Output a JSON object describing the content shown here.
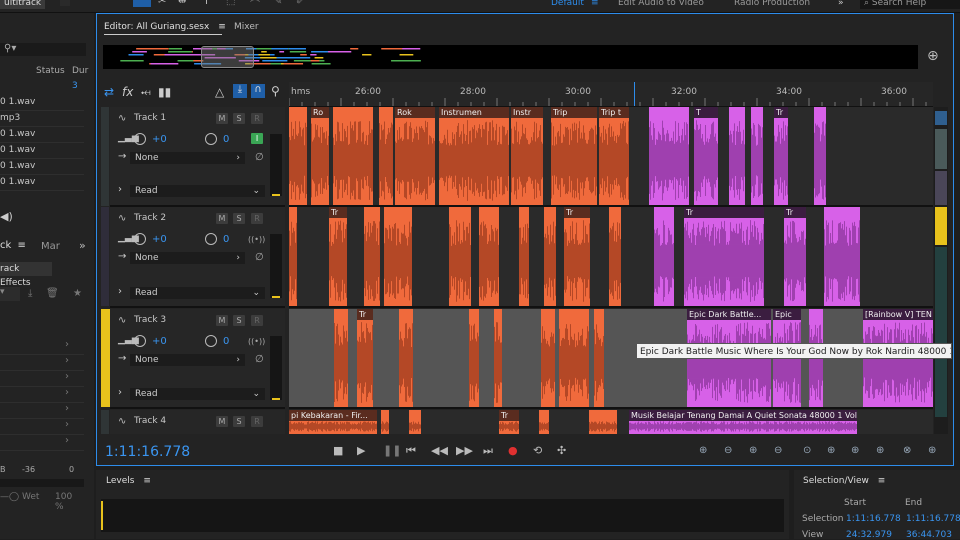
{
  "topbar": {
    "multitrack_tab": "ultitrack",
    "workspaces": [
      "Default",
      "Edit Audio to Video",
      "Radio Production"
    ],
    "overflow": "»",
    "search_placeholder": "Search Help"
  },
  "files": {
    "columns": [
      "Status",
      "Dur"
    ],
    "rows": [
      "0 1.wav",
      "mp3",
      "0 1.wav",
      "0 1.wav",
      "0 1.wav",
      "0 1.wav"
    ],
    "marker_count": "3"
  },
  "left_lower": {
    "tab_track": "ck",
    "tab_markers": "Mar",
    "overflow": "»",
    "track_effects_btn": "rack Effects",
    "meter_labels": [
      "B",
      "-36",
      "0"
    ],
    "wet_label": "Wet",
    "wet_value": "100 %"
  },
  "editor": {
    "tab_label": "Editor: All Guriang.sesx",
    "mixer_label": "Mixer"
  },
  "ruler": {
    "labels": [
      "hms",
      "26:00",
      "28:00",
      "30:00",
      "32:00",
      "34:00",
      "36:00"
    ]
  },
  "tracks": [
    {
      "name": "Track 1",
      "volume": "+0",
      "pan": "0",
      "input": "None",
      "automation": "Read"
    },
    {
      "name": "Track 2",
      "volume": "+0",
      "pan": "0",
      "input": "None",
      "automation": "Read"
    },
    {
      "name": "Track 3",
      "volume": "+0",
      "pan": "0",
      "input": "None",
      "automation": "Read"
    },
    {
      "name": "Track 4"
    }
  ],
  "track_buttons": {
    "mute": "M",
    "solo": "S",
    "record": "R",
    "input": "I"
  },
  "clips": {
    "t1": [
      "Ro",
      "Rok",
      "Instrumen",
      "Instr",
      "Trip",
      "Trip t",
      "T",
      "Tr"
    ],
    "t2": [
      "Tr",
      "Tr",
      "Tr",
      "Tr"
    ],
    "t3": [
      "Tr",
      "Epic Dark Battle...",
      "Epic",
      "[Rainbow V] TEN X"
    ],
    "t4": [
      "pi Kebakaran - Fir...",
      "Tr",
      "Musik Belajar Tenang Damai A Quiet Sonata 48000 1 Vol..."
    ]
  },
  "tooltip": "Epic Dark Battle Music Where Is Your God Now by Rok Nardin 48000 1",
  "transport": {
    "timecode": "1:11:16.778"
  },
  "levels": {
    "title": "Levels"
  },
  "selection_view": {
    "title": "Selection/View",
    "start_label": "Start",
    "end_label": "End",
    "selection_label": "Selection",
    "view_label": "View",
    "selection_start": "1:11:16.778",
    "selection_end": "1:11:16.778",
    "view_start": "24:32.979",
    "view_end": "36:44.703"
  },
  "colors": {
    "accent": "#2d8ceb",
    "clip_orange": "#f06a3c",
    "clip_purple": "#d761e8",
    "track3_selected": "#e8c21c"
  }
}
